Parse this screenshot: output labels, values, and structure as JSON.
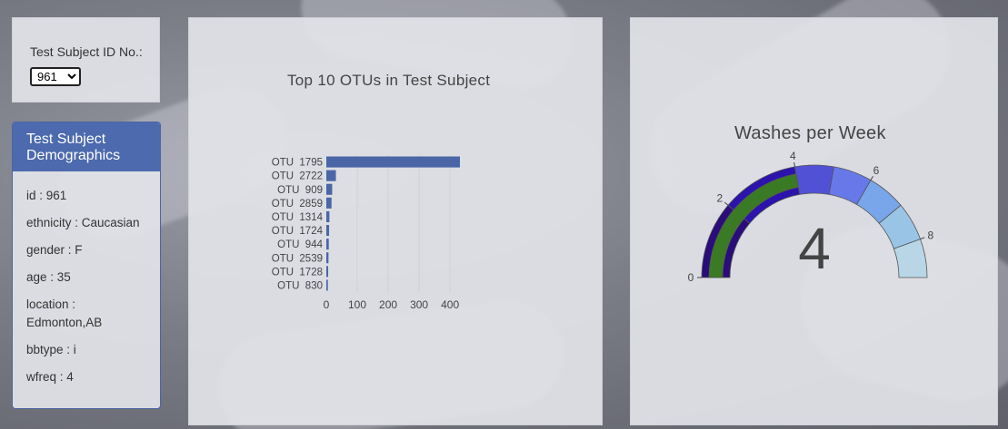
{
  "selector": {
    "label": "Test Subject ID No.:",
    "selected": "961"
  },
  "demographics": {
    "title": "Test Subject Demographics",
    "items": [
      "id : 961",
      "ethnicity : Caucasian",
      "gender : F",
      "age : 35",
      "location : Edmonton,AB",
      "bbtype : i",
      "wfreq : 4"
    ]
  },
  "bar_chart": {
    "title": "Top 10 OTUs in Test Subject"
  },
  "gauge_chart": {
    "title": "Washes per Week",
    "value_label": "4"
  },
  "colors": {
    "bar": "#4b66a6",
    "gauge_bands": [
      "#2a0c7a",
      "#2c13ad",
      "#5151d6",
      "#6779e8",
      "#79a6ea",
      "#99c4e6",
      "#b8d6e6"
    ],
    "gauge_value_bar": "#3b7a24"
  },
  "chart_data": [
    {
      "type": "bar",
      "orientation": "horizontal",
      "title": "Top 10 OTUs in Test Subject",
      "categories": [
        "OTU  1795",
        "OTU  2722",
        "OTU  909",
        "OTU  2859",
        "OTU  1314",
        "OTU  1724",
        "OTU  944",
        "OTU  2539",
        "OTU  1728",
        "OTU  830"
      ],
      "values": [
        432,
        31,
        19,
        17,
        10,
        9,
        8,
        7,
        6,
        5
      ],
      "xlim": [
        0,
        432
      ],
      "xticks": [
        0,
        100,
        200,
        300,
        400
      ],
      "grid": true
    },
    {
      "type": "gauge",
      "title": "Washes per Week",
      "value": 4,
      "range": [
        0,
        9
      ],
      "ticks": [
        0,
        2,
        4,
        6,
        8
      ]
    }
  ]
}
